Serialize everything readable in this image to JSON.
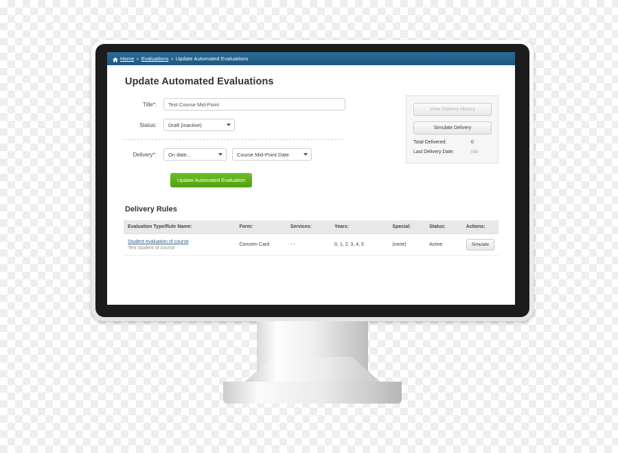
{
  "breadcrumb": {
    "home_icon": "home-icon",
    "home_label": "Home",
    "sep1": "»",
    "evaluations_label": "Evaluations",
    "sep2": "»",
    "current_label": "Update Automated Evaluations"
  },
  "page": {
    "title": "Update Automated Evaluations"
  },
  "form": {
    "title_label": "Title*:",
    "title_value": "Test Course Mid-Point",
    "title_placeholder": "Test Course Mid-Point",
    "status_label": "Status:",
    "status_value": "Draft (inactive)",
    "delivery_label": "Delivery*:",
    "delivery_value": "On date...",
    "delivery_date_value": "Course Mid-Point Date",
    "submit_label": "Update Automated Evaluation"
  },
  "side_panel": {
    "view_history_label": "View Delivery History",
    "simulate_delivery_label": "Simulate Delivery",
    "total_delivered_label": "Total Delivered:",
    "total_delivered_value": "0",
    "last_delivery_label": "Last Delivery Date:",
    "last_delivery_value": "n/a"
  },
  "delivery_rules": {
    "section_title": "Delivery Rules",
    "columns": [
      "Evaluation Type/Rule Name:",
      "Form:",
      "Services:",
      "Years:",
      "Special:",
      "Status:",
      "Actions:"
    ],
    "rows": [
      {
        "rule_name": "Student evaluation of course",
        "rule_sub": "Test student of course",
        "form": "Concern Card",
        "services": "- -",
        "years": "0, 1, 2, 3, 4, 5",
        "special": "(none)",
        "status": "Active",
        "action_label": "Simulate"
      }
    ]
  },
  "colors": {
    "breadcrumb_bg": "#1c5781",
    "primary_button": "#5cb316",
    "link": "#2a5f8f"
  }
}
